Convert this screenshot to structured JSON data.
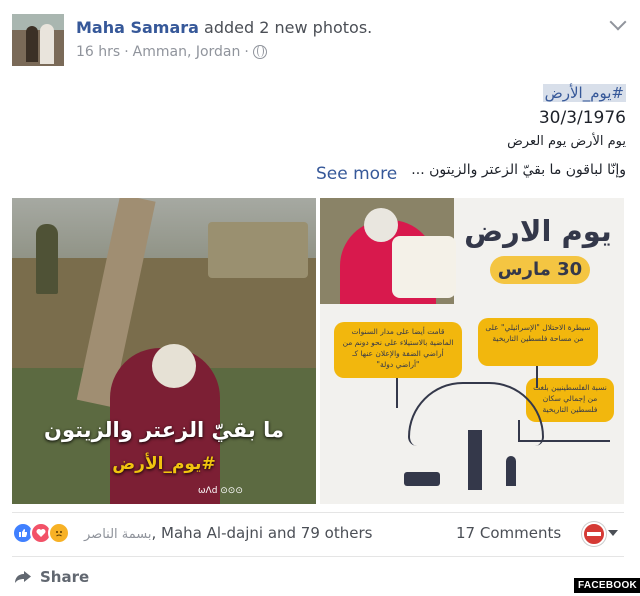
{
  "header": {
    "author": "Maha Samara",
    "action": "added 2 new photos.",
    "time": "16 hrs",
    "location": "Amman, Jordan",
    "separator": "·"
  },
  "post": {
    "hashtag": "#يوم_الأرض",
    "date": "30/3/1976",
    "line1": "يوم الأرض يوم العرض",
    "line2": "وإنّا لباقون ما بقيّ الزعتر والزيتون ...",
    "see_more": "See more"
  },
  "photo1": {
    "caption": "ما بقيّ الزعتر والزيتون",
    "hashtag": "#يوم_الأرض",
    "logo": "ωΛd ⊙⊙⊙"
  },
  "photo2": {
    "title": "يوم الارض",
    "date_badge": "30 مارس",
    "box1": "قامت أيضا على مدار السنوات الماضية بالاستيلاء على نحو دونم من أراضي الضفة والإعلان عنها كـ \"أراضي دولة\"",
    "box2": "سيطرة الاحتلال \"الإسرائيلي\" على من مساحة فلسطين التاريخية",
    "box3": "نسبة الفلسطينيين بلغت من إجمالي سكان فلسطين التاريخية"
  },
  "stats": {
    "reactors_rtl": "بسمة الناصر",
    "reactors": ", Maha Al-dajni and 79 others",
    "comments": "17 Comments"
  },
  "actions": {
    "share": "Share"
  },
  "watermark": "FACEBOOK",
  "colors": {
    "link": "#365899",
    "secondary_text": "#90949c",
    "like": "#4080ff",
    "love": "#f25268",
    "sad": "#f7b125",
    "infographic_yellow": "#f2b70d"
  },
  "icons": [
    "globe-icon",
    "chevron-down-icon",
    "like-reaction-icon",
    "love-reaction-icon",
    "sad-reaction-icon",
    "share-icon",
    "caret-down-icon"
  ]
}
